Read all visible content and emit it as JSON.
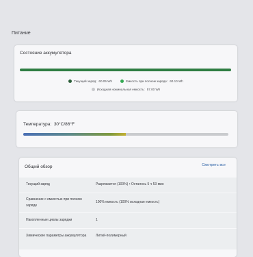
{
  "page": {
    "title": "Питание"
  },
  "battery": {
    "title": "Состояние аккумулятора",
    "health_fraction": 1.0,
    "fill_color": "#2f7d43",
    "legend": {
      "current_label": "Текущий заряд:",
      "current_value": "60.05 Wh",
      "full_label": "Емкость при полном заряде:",
      "full_value": "60.10 Wh",
      "design_label": "Исходная номинальная емкость:",
      "design_value": "57.00 Wh"
    },
    "legend_colors": {
      "current": "#2c5e3a",
      "full": "#34a853",
      "design": "#c8c9cc"
    }
  },
  "temperature": {
    "label": "Температура:",
    "value": "30°C/86°F",
    "level_fraction": 0.5
  },
  "overview": {
    "title": "Общий обзор",
    "see_all": "Смотреть все",
    "rows": [
      {
        "label": "Текущий заряд",
        "value": "Разряжается (100%) • Осталось 5 ч 53 мин"
      },
      {
        "label": "Сравнение с емкостью при полном заряде",
        "value": "100% емкость (100% исходная емкость)"
      },
      {
        "label": "Накопленные циклы зарядки",
        "value": "1"
      },
      {
        "label": "Химические параметры аккумулятора",
        "value": "Литий-полимерный"
      }
    ]
  }
}
